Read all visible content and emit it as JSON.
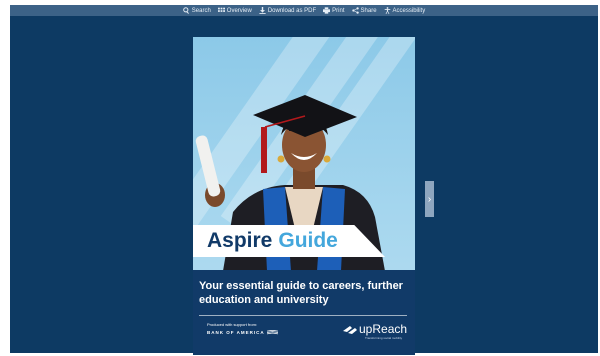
{
  "toolbar": {
    "items": [
      {
        "label": "Search",
        "icon": "search-icon"
      },
      {
        "label": "Overview",
        "icon": "grid-icon"
      },
      {
        "label": "Download as PDF",
        "icon": "download-icon"
      },
      {
        "label": "Print",
        "icon": "print-icon"
      },
      {
        "label": "Share",
        "icon": "share-icon"
      },
      {
        "label": "Accessibility",
        "icon": "accessibility-icon"
      }
    ]
  },
  "cover": {
    "title_part1": "Aspire",
    "title_part2": "Guide",
    "subtitle": "Your essential guide to careers, further education and university",
    "produced_with": "Produced with support from:",
    "sponsor": "BANK OF AMERICA",
    "partner": "upReach",
    "partner_tagline": "Transforming social mobility"
  },
  "navigation": {
    "next_arrow": "›"
  },
  "colors": {
    "viewer_bg": "#0d3a63",
    "toolbar_bg": "#3c6287",
    "navy": "#113a68",
    "accent_blue": "#44a7dc"
  }
}
